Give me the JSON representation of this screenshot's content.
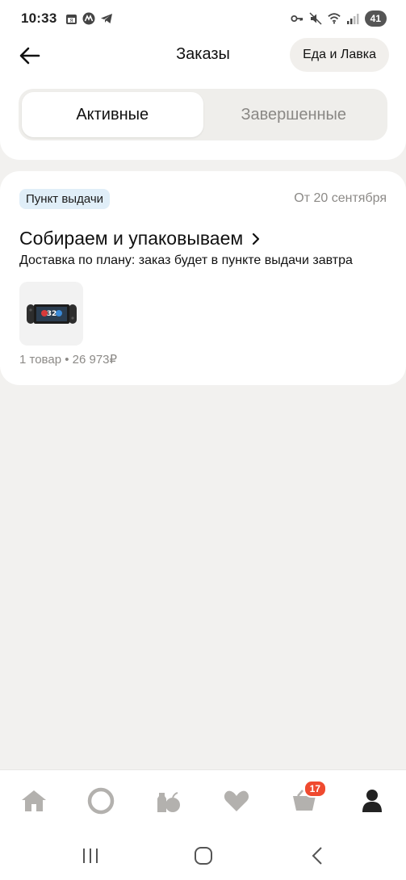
{
  "status_bar": {
    "time": "10:33",
    "battery": "41",
    "left_icons": [
      "calendar-icon",
      "metro-icon",
      "telegram-icon"
    ],
    "right_icons": [
      "key-icon",
      "mute-icon",
      "wifi-icon",
      "signal-icon"
    ]
  },
  "header": {
    "title": "Заказы",
    "food_button_label": "Еда и Лавка"
  },
  "tabs": [
    {
      "label": "Активные",
      "active": true
    },
    {
      "label": "Завершенные",
      "active": false
    }
  ],
  "order": {
    "badge": "Пункт выдачи",
    "date": "От 20 сентября",
    "status": "Собираем и упаковываем",
    "description": "Доставка по плану: заказ будет в пункте выдачи завтра",
    "summary": "1 товар • 26 973₽",
    "product_image": "game-console-image"
  },
  "bottom_nav": {
    "items": [
      "home-icon",
      "alice-icon",
      "grocery-icon",
      "favorites-icon",
      "cart-icon",
      "profile-icon"
    ],
    "cart_count": "17",
    "active": "profile-icon"
  },
  "android_nav": [
    "recent-apps-icon",
    "home-circle-icon",
    "back-icon"
  ],
  "colors": {
    "background": "#f2f1ef",
    "badge_bg": "#e0eef8",
    "cart_badge": "#ef4a2f",
    "muted_text": "#8c8a87"
  }
}
